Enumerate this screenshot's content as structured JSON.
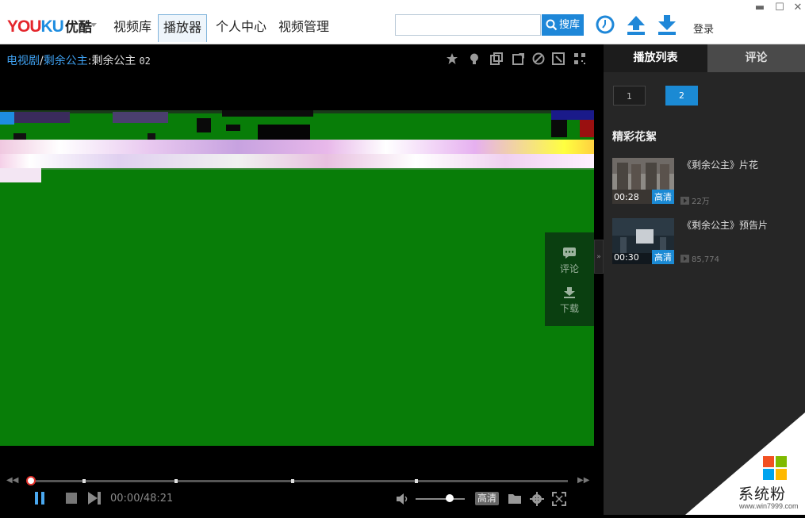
{
  "logo": {
    "part1": "YOU",
    "part2": "KU",
    "cn": "优酷"
  },
  "nav": {
    "tabs": [
      "视频库",
      "播放器",
      "个人中心",
      "视频管理"
    ],
    "active": "播放器"
  },
  "search": {
    "placeholder": "",
    "button": "搜库"
  },
  "top": {
    "login": "登录",
    "min": "▬",
    "max": "☐",
    "close": "✕"
  },
  "breadcrumb": {
    "category": "电视剧",
    "sep1": "/",
    "show": "剩余公主",
    "sep2": ":",
    "title": "剩余公主",
    "episode": "02"
  },
  "side_panel": {
    "comment": "评论",
    "download": "下载"
  },
  "player": {
    "time": "00:00/48:21",
    "quality": "高清",
    "progress": 0.0,
    "volume": 0.7
  },
  "sidebar": {
    "tabs": [
      "播放列表",
      "评论"
    ],
    "episodes": [
      "1",
      "2"
    ],
    "selected_episode": "2",
    "section_title": "精彩花絮",
    "clips": [
      {
        "title": "《剩余公主》片花",
        "duration": "00:28",
        "quality": "高清",
        "views": "22万"
      },
      {
        "title": "《剩余公主》预告片",
        "duration": "00:30",
        "quality": "高清",
        "views": "85,774"
      }
    ]
  },
  "watermark": {
    "brand": "系统粉",
    "url": "www.win7999.com"
  },
  "colors": {
    "accent": "#1e87d8",
    "video_frame": "#087d08",
    "logo_red": "#e4262c"
  }
}
